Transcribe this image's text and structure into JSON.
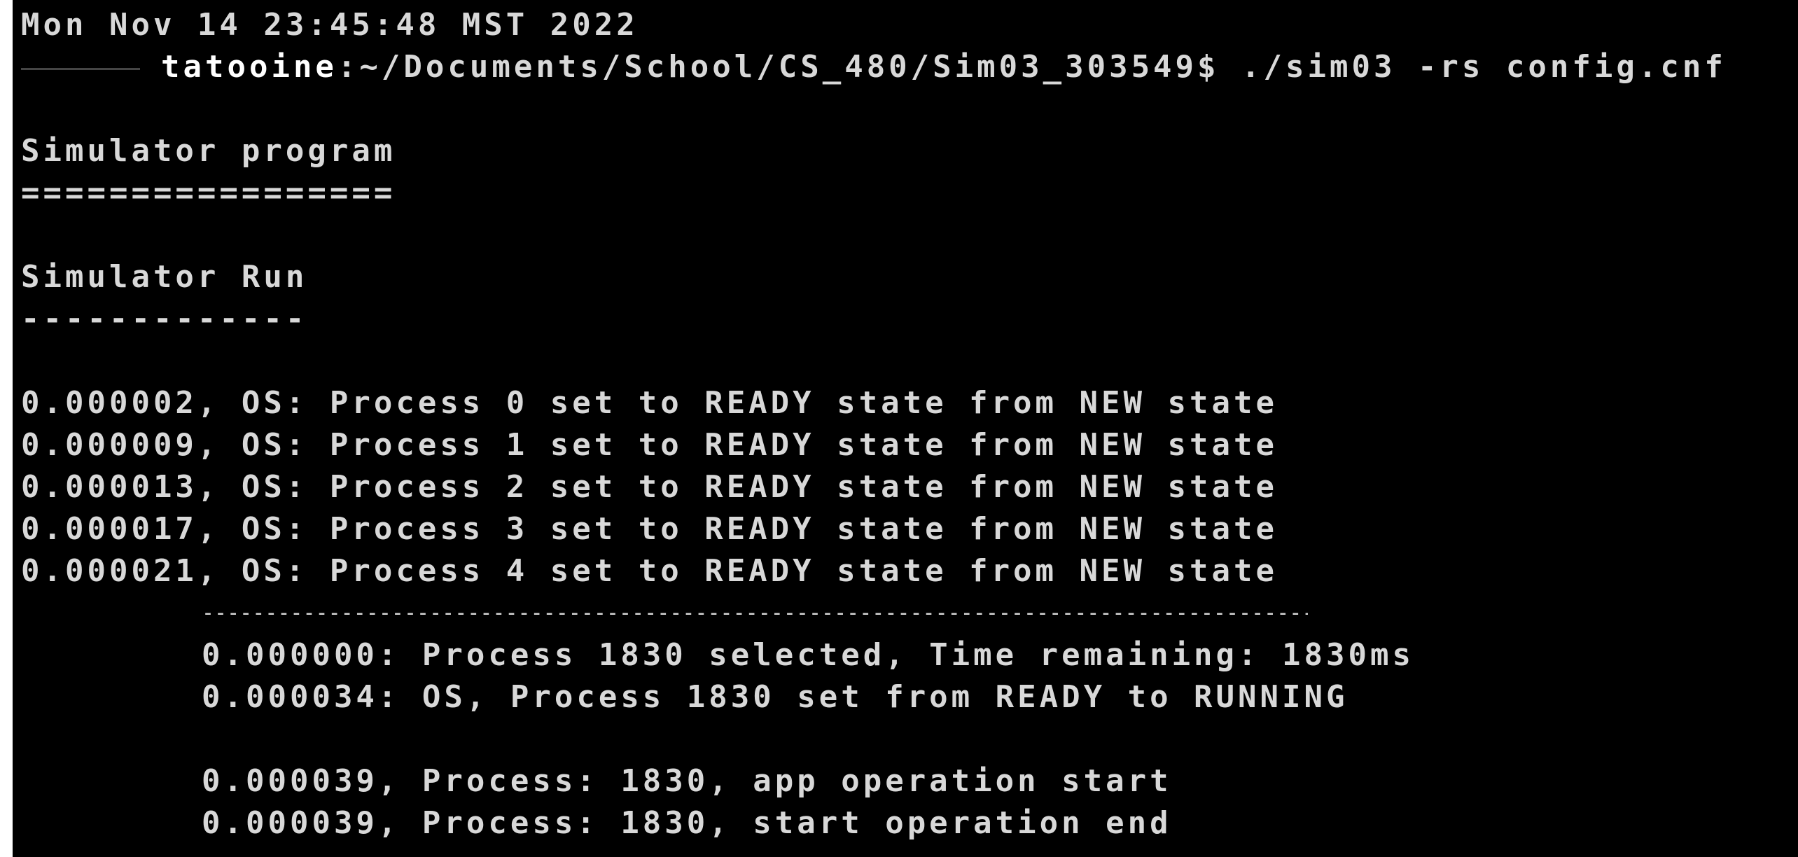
{
  "terminal": {
    "date_line": "Mon Nov 14 23:45:48 MST 2022",
    "prompt": {
      "host": "tatooine",
      "path_and_command": ":~/Documents/School/CS_480/Sim03_303549$ ./sim03 -rs config.cnf"
    },
    "title": "Simulator program",
    "title_rule": "=================",
    "subtitle": "Simulator Run",
    "subtitle_rule": "-------------",
    "process_lines": [
      "0.000002, OS: Process 0 set to READY state from NEW state",
      "0.000009, OS: Process 1 set to READY state from NEW state",
      "0.000013, OS: Process 2 set to READY state from NEW state",
      "0.000017, OS: Process 3 set to READY state from NEW state",
      "0.000021, OS: Process 4 set to READY state from NEW state"
    ],
    "separator": "--------------------------------------------------------------------------------------------------",
    "log_lines": [
      "0.000000: Process 1830 selected, Time remaining: 1830ms",
      "0.000034: OS, Process 1830 set from READY to RUNNING",
      "0.000039, Process: 1830, app operation start",
      "0.000039, Process: 1830, start operation end"
    ]
  }
}
